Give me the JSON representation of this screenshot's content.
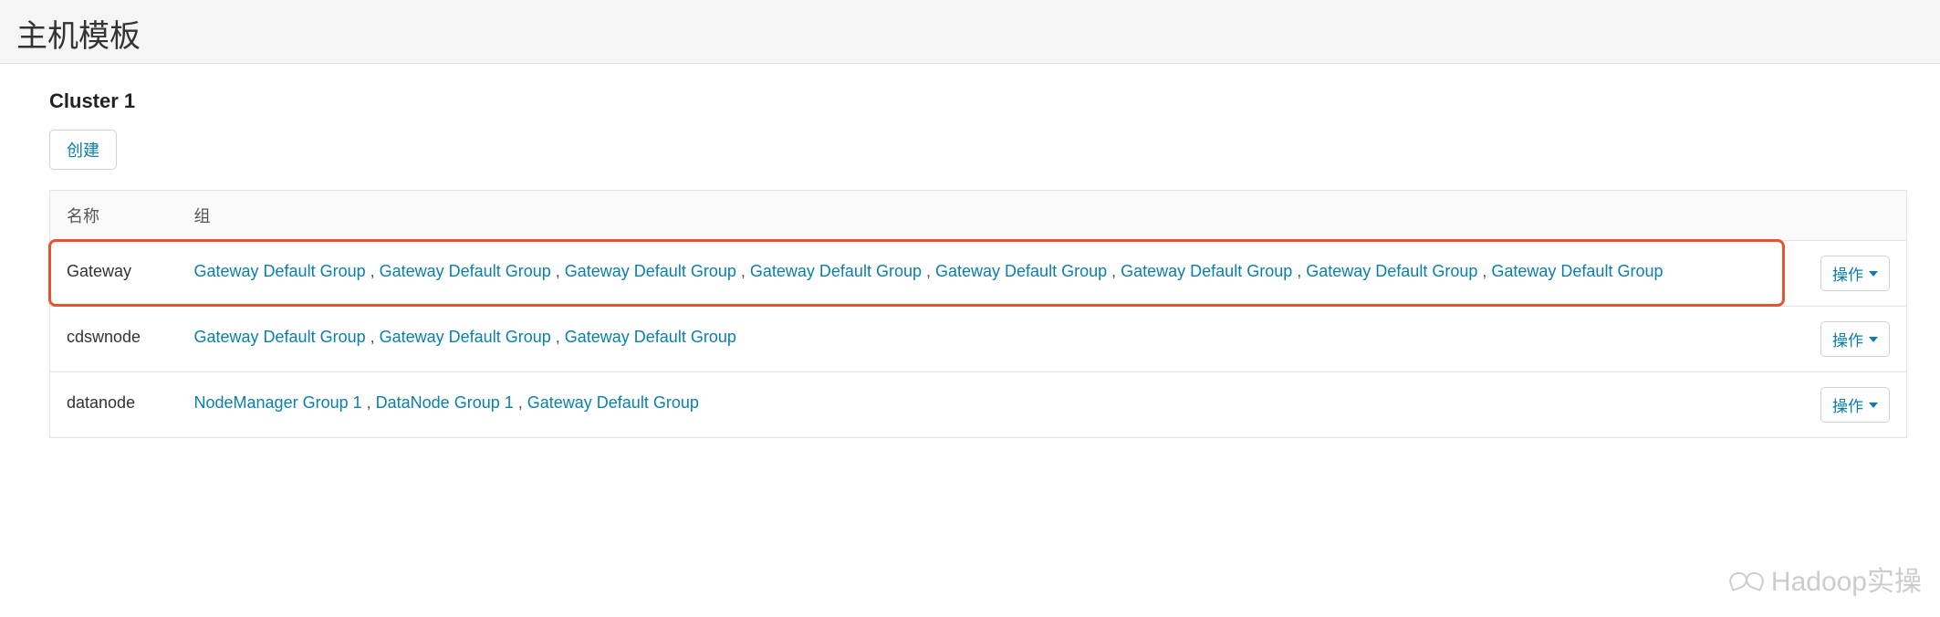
{
  "header": {
    "title": "主机模板"
  },
  "cluster": {
    "name": "Cluster 1"
  },
  "buttons": {
    "create": "创建",
    "action": "操作"
  },
  "table": {
    "columns": {
      "name": "名称",
      "group": "组"
    },
    "rows": [
      {
        "name": "Gateway",
        "highlight": true,
        "groups": [
          "Gateway Default Group",
          "Gateway Default Group",
          "Gateway Default Group",
          "Gateway Default Group",
          "Gateway Default Group",
          "Gateway Default Group",
          "Gateway Default Group",
          "Gateway Default Group"
        ]
      },
      {
        "name": "cdswnode",
        "highlight": false,
        "groups": [
          "Gateway Default Group",
          "Gateway Default Group",
          "Gateway Default Group"
        ]
      },
      {
        "name": "datanode",
        "highlight": false,
        "groups": [
          "NodeManager Group 1",
          "DataNode Group 1",
          "Gateway Default Group"
        ]
      }
    ]
  },
  "watermark": "Hadoop实操"
}
